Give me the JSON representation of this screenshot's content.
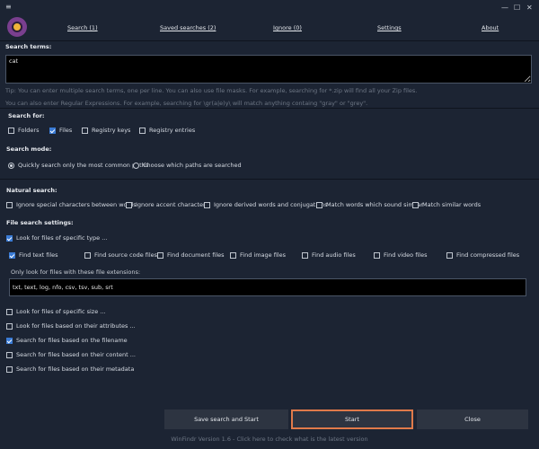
{
  "window": {
    "menu_glyph": "≡",
    "minimize_glyph": "—",
    "maximize_glyph": "☐",
    "close_glyph": "✕"
  },
  "tabs": [
    {
      "label": "Search (1)"
    },
    {
      "label": "Saved searches (2)"
    },
    {
      "label": "Ignore (0)"
    },
    {
      "label": "Settings"
    },
    {
      "label": "About"
    }
  ],
  "search": {
    "title": "Search terms:",
    "value": "cat",
    "hint1": "Tip: You can enter multiple search terms, one per line. You can also use file masks. For example, searching for *.zip will find all your Zip files.",
    "hint2": "You can also enter Regular Expressions. For example, searching for \\gr(a|e)y\\ will match anything containg \"gray\" or \"grey\"."
  },
  "search_for": {
    "title": "Search for:",
    "items": [
      {
        "label": "Folders",
        "checked": false
      },
      {
        "label": "Files",
        "checked": true
      },
      {
        "label": "Registry keys",
        "checked": false
      },
      {
        "label": "Registry entries",
        "checked": false
      }
    ]
  },
  "search_mode": {
    "title": "Search mode:",
    "options": [
      {
        "label": "Quickly search only the most common paths",
        "selected": true
      },
      {
        "label": "Choose which paths are searched",
        "selected": false
      }
    ]
  },
  "natural": {
    "title": "Natural search:",
    "items": [
      {
        "label": "Ignore special characters between words",
        "checked": false
      },
      {
        "label": "Ignore accent characters",
        "checked": false
      },
      {
        "label": "Ignore derived words and conjugations",
        "checked": false
      },
      {
        "label": "Match words which sound similar",
        "checked": false
      },
      {
        "label": "Match similar words",
        "checked": false
      }
    ]
  },
  "file_settings": {
    "title": "File search settings:",
    "look_specific_type": {
      "label": "Look for files of specific type ...",
      "checked": true
    },
    "types": [
      {
        "label": "Find text files",
        "checked": true
      },
      {
        "label": "Find source code files",
        "checked": false
      },
      {
        "label": "Find document files",
        "checked": false
      },
      {
        "label": "Find image files",
        "checked": false
      },
      {
        "label": "Find audio files",
        "checked": false
      },
      {
        "label": "Find video files",
        "checked": false
      },
      {
        "label": "Find compressed files",
        "checked": false
      }
    ],
    "ext_label": "Only look for files with these file extensions:",
    "ext_value": "txt, text, log, nfo, csv, tsv, sub, srt",
    "options": [
      {
        "label": "Look for files of specific size ...",
        "checked": false
      },
      {
        "label": "Look for files based on their attributes ...",
        "checked": false
      },
      {
        "label": "Search for files based on the filename",
        "checked": true
      },
      {
        "label": "Search for files based on their content ...",
        "checked": false
      },
      {
        "label": "Search for files based on their metadata",
        "checked": false
      }
    ]
  },
  "buttons": {
    "save_start": "Save search and Start",
    "start": "Start",
    "close": "Close"
  },
  "version": "WinFindr Version 1.6 - Click here to check what is the latest version",
  "colors": {
    "background": "#1c2433",
    "accent_check": "#3a7bd5",
    "start_outline": "#e07a4a"
  }
}
